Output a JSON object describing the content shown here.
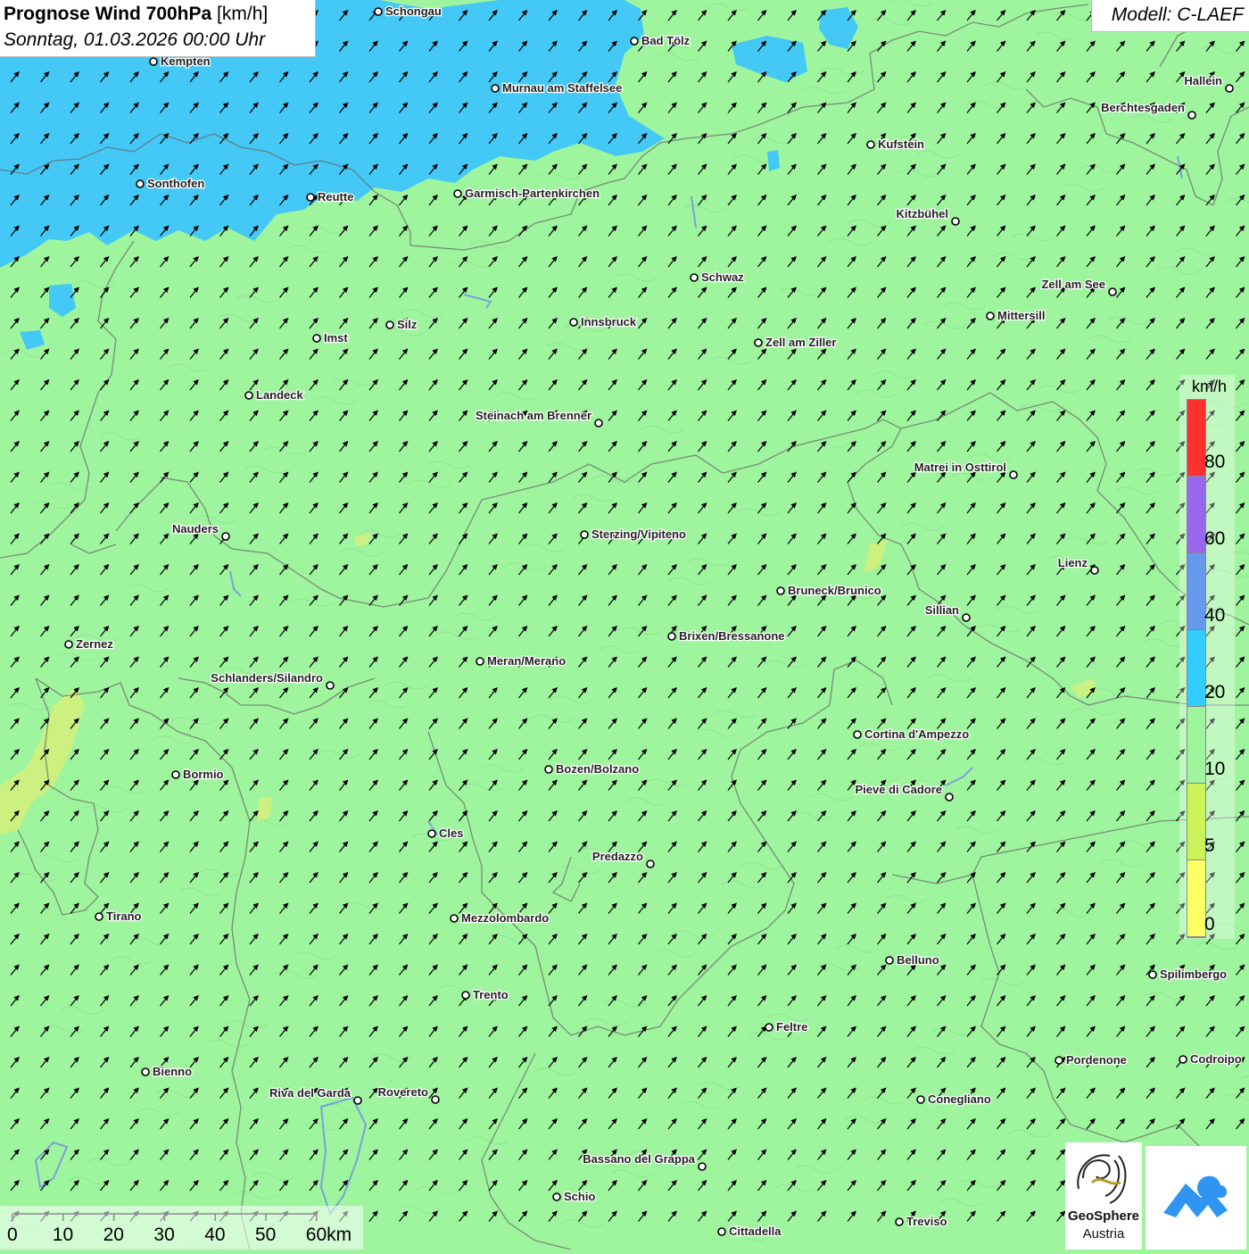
{
  "header": {
    "title_bold": "Prognose Wind 700hPa",
    "title_unit": "[km/h]",
    "subtitle": "Sonntag, 01.03.2026 00:00 Uhr",
    "model": "Modell: C-LAEF"
  },
  "legend": {
    "unit": "km/h",
    "labels": [
      "80",
      "60",
      "40",
      "20",
      "10",
      "5",
      "0"
    ],
    "colors_top_to_bottom": [
      "#ff3030",
      "#9966ee",
      "#6699ee",
      "#33ccff",
      "#9ef59e",
      "#ccf45a",
      "#ffff66"
    ]
  },
  "cities": [
    {
      "name": "Schongau"
    },
    {
      "name": "Kempten"
    },
    {
      "name": "Bad Tölz"
    },
    {
      "name": "Murnau am Staffelsee"
    },
    {
      "name": "Hallein"
    },
    {
      "name": "Berchtesgaden"
    },
    {
      "name": "Kufstein"
    },
    {
      "name": "Sonthofen"
    },
    {
      "name": "Reutte"
    },
    {
      "name": "Garmisch-Partenkirchen"
    },
    {
      "name": "Kitzbühel"
    },
    {
      "name": "Schwaz"
    },
    {
      "name": "Zell am See"
    },
    {
      "name": "Mittersill"
    },
    {
      "name": "Silz"
    },
    {
      "name": "Innsbruck"
    },
    {
      "name": "Imst"
    },
    {
      "name": "Zell am Ziller"
    },
    {
      "name": "Landeck"
    },
    {
      "name": "Steinach am Brenner"
    },
    {
      "name": "Matrei in Osttirol"
    },
    {
      "name": "Nauders"
    },
    {
      "name": "Sterzing/Vipiteno"
    },
    {
      "name": "Lienz"
    },
    {
      "name": "Bruneck/Brunico"
    },
    {
      "name": "Sillian"
    },
    {
      "name": "Brixen/Bressanone"
    },
    {
      "name": "Zernez"
    },
    {
      "name": "Meran/Merano"
    },
    {
      "name": "Schlanders/Silandro"
    },
    {
      "name": "Cortina d'Ampezzo"
    },
    {
      "name": "Bormio"
    },
    {
      "name": "Bozen/Bolzano"
    },
    {
      "name": "Pieve di Cadore"
    },
    {
      "name": "Cles"
    },
    {
      "name": "Predazzo"
    },
    {
      "name": "Tirano"
    },
    {
      "name": "Mezzolombardo"
    },
    {
      "name": "Belluno"
    },
    {
      "name": "Spilimbergo"
    },
    {
      "name": "Trento"
    },
    {
      "name": "Feltre"
    },
    {
      "name": "Pordenone"
    },
    {
      "name": "Codroipo"
    },
    {
      "name": "Bienno"
    },
    {
      "name": "Riva del Garda"
    },
    {
      "name": "Rovereto"
    },
    {
      "name": "Conegliano"
    },
    {
      "name": "Bassano del Grappa"
    },
    {
      "name": "Schio"
    },
    {
      "name": "Treviso"
    },
    {
      "name": "Cittadella"
    }
  ],
  "scale": {
    "labels": [
      "0",
      "10",
      "20",
      "30",
      "40",
      "50",
      "60km"
    ]
  },
  "logo": {
    "line1": "GeoSphere",
    "line2": "Austria"
  },
  "wind_direction": "southwest"
}
